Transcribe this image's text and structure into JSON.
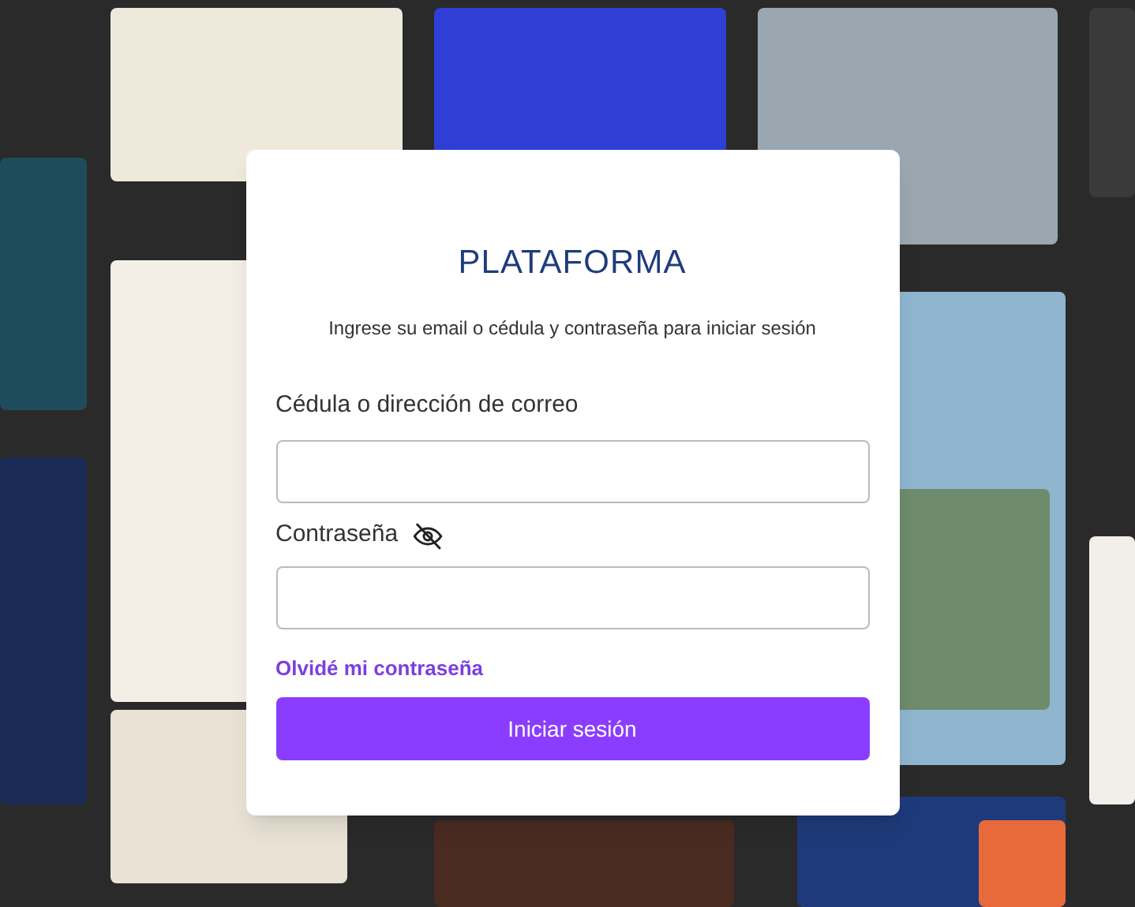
{
  "login": {
    "title": "PLATAFORMA",
    "subtitle": "Ingrese su email o cédula y contraseña para iniciar sesión",
    "fields": [
      {
        "kind": "text",
        "label": "Cédula o dirección de correo"
      },
      {
        "kind": "password",
        "label": "Contraseña"
      }
    ],
    "forgot_link": "Olvidé mi contraseña",
    "submit": "Iniciar sesión"
  }
}
